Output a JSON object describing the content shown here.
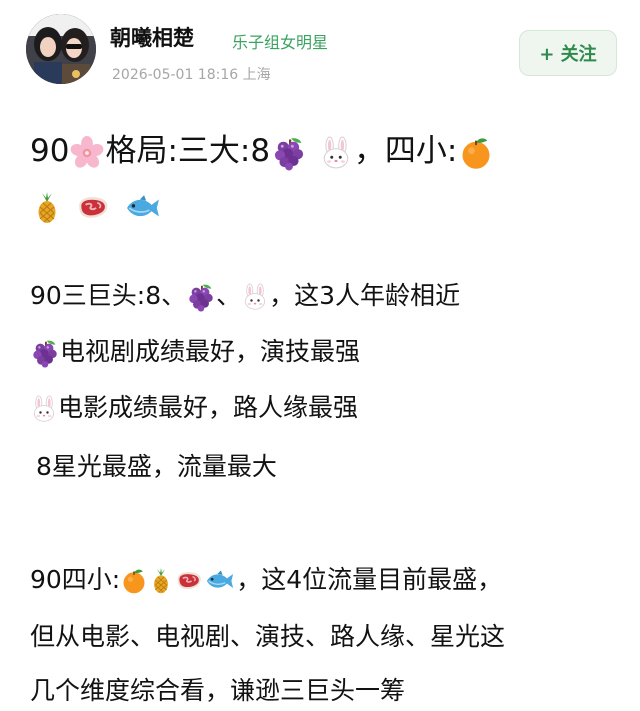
{
  "author": {
    "name": "朝曦相楚",
    "tag": "乐子组女明星",
    "meta": "2026-05-01 18:16 上海"
  },
  "follow_button": {
    "label": "+ 关注"
  },
  "post": {
    "line1": {
      "p1": "90",
      "p2": "格局:三大:8",
      "p3": "，四小:"
    },
    "line3": {
      "p1": "90三巨头:8、",
      "p2": "、",
      "p3": "，这3人年龄相近"
    },
    "line4": {
      "text": "电视剧成绩最好，演技最强"
    },
    "line5": {
      "text": "电影成绩最好，路人缘最强"
    },
    "line6": {
      "text": "8星光最盛，流量最大"
    },
    "line7": {
      "p1": "90四小:",
      "p2": "，这4位流量目前最盛，"
    },
    "line8": {
      "text": "但从电影、电视剧、演技、路人缘、星光这"
    },
    "line9": {
      "text": "几个维度综合看，谦逊三巨头一筹"
    }
  },
  "icons": {
    "cherry_blossom": "cherry-blossom-icon",
    "grape": "grape-icon",
    "rabbit": "rabbit-face-icon",
    "orange": "orange-icon",
    "pineapple": "pineapple-icon",
    "meat": "meat-icon",
    "fish": "fish-icon"
  },
  "colors": {
    "accent_green": "#3aa35f",
    "follow_bg": "#eef6ef",
    "meta_gray": "#a6a6a6"
  }
}
